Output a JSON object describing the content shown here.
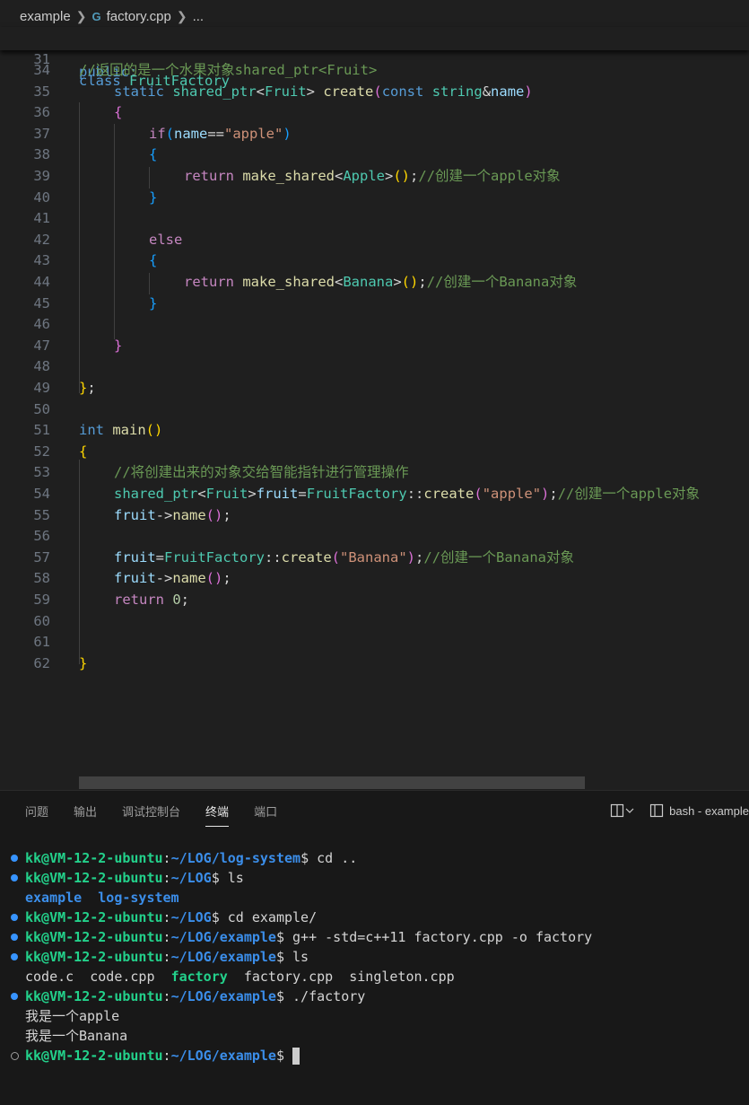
{
  "breadcrumb": {
    "folder": "example",
    "cpp_icon": "C++ file icon",
    "file": "factory.cpp",
    "more": "..."
  },
  "sticky": {
    "line_number": "31",
    "keyword": "class",
    "name": "FruitFactory",
    "partial": "public:"
  },
  "editor": {
    "lines": [
      {
        "n": "34",
        "ind": 0,
        "t": [
          [
            "cm",
            "//返回的是一个水果对象shared_ptr<Fruit>"
          ]
        ]
      },
      {
        "n": "35",
        "ind": 1,
        "t": [
          [
            "kw",
            "static "
          ],
          [
            "ty",
            "shared_ptr"
          ],
          [
            "pl",
            "<"
          ],
          [
            "ty",
            "Fruit"
          ],
          [
            "pl",
            "> "
          ],
          [
            "fn",
            "create"
          ],
          [
            "b2",
            "("
          ],
          [
            "kw",
            "const "
          ],
          [
            "ty",
            "string"
          ],
          [
            "pl",
            "&"
          ],
          [
            "vr",
            "name"
          ],
          [
            "b2",
            ")"
          ]
        ]
      },
      {
        "n": "36",
        "ind": 1,
        "t": [
          [
            "b2",
            "{"
          ]
        ]
      },
      {
        "n": "37",
        "ind": 2,
        "t": [
          [
            "ctl",
            "if"
          ],
          [
            "b3",
            "("
          ],
          [
            "vr",
            "name"
          ],
          [
            "pl",
            "=="
          ],
          [
            "st",
            "\"apple\""
          ],
          [
            "b3",
            ")"
          ]
        ]
      },
      {
        "n": "38",
        "ind": 2,
        "t": [
          [
            "b3",
            "{"
          ]
        ]
      },
      {
        "n": "39",
        "ind": 3,
        "t": [
          [
            "ctl",
            "return "
          ],
          [
            "fn",
            "make_shared"
          ],
          [
            "pl",
            "<"
          ],
          [
            "ty",
            "Apple"
          ],
          [
            "pl",
            ">"
          ],
          [
            "b1",
            "()"
          ],
          [
            "pl",
            ";"
          ],
          [
            "cm",
            "//创建一个apple对象"
          ]
        ]
      },
      {
        "n": "40",
        "ind": 2,
        "t": [
          [
            "b3",
            "}"
          ]
        ]
      },
      {
        "n": "41",
        "ind": 0,
        "t": []
      },
      {
        "n": "42",
        "ind": 2,
        "t": [
          [
            "ctl",
            "else"
          ]
        ]
      },
      {
        "n": "43",
        "ind": 2,
        "t": [
          [
            "b3",
            "{"
          ]
        ]
      },
      {
        "n": "44",
        "ind": 3,
        "t": [
          [
            "ctl",
            "return "
          ],
          [
            "fn",
            "make_shared"
          ],
          [
            "pl",
            "<"
          ],
          [
            "ty",
            "Banana"
          ],
          [
            "pl",
            ">"
          ],
          [
            "b1",
            "()"
          ],
          [
            "pl",
            ";"
          ],
          [
            "cm",
            "//创建一个Banana对象"
          ]
        ]
      },
      {
        "n": "45",
        "ind": 2,
        "t": [
          [
            "b3",
            "}"
          ]
        ]
      },
      {
        "n": "46",
        "ind": 0,
        "t": []
      },
      {
        "n": "47",
        "ind": 1,
        "t": [
          [
            "b2",
            "}"
          ]
        ]
      },
      {
        "n": "48",
        "ind": 0,
        "t": []
      },
      {
        "n": "49",
        "ind": 0,
        "t": [
          [
            "b1",
            "}"
          ],
          [
            "pl",
            ";"
          ]
        ]
      },
      {
        "n": "50",
        "ind": 0,
        "t": []
      },
      {
        "n": "51",
        "ind": 0,
        "t": [
          [
            "kw",
            "int "
          ],
          [
            "fn",
            "main"
          ],
          [
            "b1",
            "()"
          ]
        ]
      },
      {
        "n": "52",
        "ind": 0,
        "t": [
          [
            "b1",
            "{"
          ]
        ]
      },
      {
        "n": "53",
        "ind": 1,
        "t": [
          [
            "cm",
            "//将创建出来的对象交给智能指针进行管理操作"
          ]
        ]
      },
      {
        "n": "54",
        "ind": 1,
        "t": [
          [
            "ty",
            "shared_ptr"
          ],
          [
            "pl",
            "<"
          ],
          [
            "ty",
            "Fruit"
          ],
          [
            "pl",
            ">"
          ],
          [
            "vr",
            "fruit"
          ],
          [
            "pl",
            "="
          ],
          [
            "ty",
            "FruitFactory"
          ],
          [
            "pl",
            "::"
          ],
          [
            "fn",
            "create"
          ],
          [
            "b2",
            "("
          ],
          [
            "st",
            "\"apple\""
          ],
          [
            "b2",
            ")"
          ],
          [
            "pl",
            ";"
          ],
          [
            "cm",
            "//创建一个apple对象"
          ]
        ]
      },
      {
        "n": "55",
        "ind": 1,
        "t": [
          [
            "vr",
            "fruit"
          ],
          [
            "pl",
            "->"
          ],
          [
            "fn",
            "name"
          ],
          [
            "b2",
            "()"
          ],
          [
            "pl",
            ";"
          ]
        ]
      },
      {
        "n": "56",
        "ind": 0,
        "t": []
      },
      {
        "n": "57",
        "ind": 1,
        "t": [
          [
            "vr",
            "fruit"
          ],
          [
            "pl",
            "="
          ],
          [
            "ty",
            "FruitFactory"
          ],
          [
            "pl",
            "::"
          ],
          [
            "fn",
            "create"
          ],
          [
            "b2",
            "("
          ],
          [
            "st",
            "\"Banana\""
          ],
          [
            "b2",
            ")"
          ],
          [
            "pl",
            ";"
          ],
          [
            "cm",
            "//创建一个Banana对象"
          ]
        ]
      },
      {
        "n": "58",
        "ind": 1,
        "t": [
          [
            "vr",
            "fruit"
          ],
          [
            "pl",
            "->"
          ],
          [
            "fn",
            "name"
          ],
          [
            "b2",
            "()"
          ],
          [
            "pl",
            ";"
          ]
        ]
      },
      {
        "n": "59",
        "ind": 1,
        "t": [
          [
            "ctl",
            "return "
          ],
          [
            "nm",
            "0"
          ],
          [
            "pl",
            ";"
          ]
        ]
      },
      {
        "n": "60",
        "ind": 0,
        "t": []
      },
      {
        "n": "61",
        "ind": 0,
        "t": []
      },
      {
        "n": "62",
        "ind": 0,
        "t": [
          [
            "b1",
            "}"
          ]
        ]
      }
    ]
  },
  "panel": {
    "tabs": [
      "问题",
      "输出",
      "调试控制台",
      "终端",
      "端口"
    ],
    "active_tab": "终端",
    "split_icon": "split-terminal-icon",
    "terminal_name": "bash - example"
  },
  "terminal": {
    "lines": [
      {
        "dot": "filled",
        "t": [
          [
            "u",
            "kk@VM-12-2-ubuntu"
          ],
          [
            "pl",
            ":"
          ],
          [
            "p",
            "~/LOG/log-system"
          ],
          [
            "pl",
            "$ cd .."
          ]
        ]
      },
      {
        "dot": "filled",
        "t": [
          [
            "u",
            "kk@VM-12-2-ubuntu"
          ],
          [
            "pl",
            ":"
          ],
          [
            "p",
            "~/LOG"
          ],
          [
            "pl",
            "$ ls"
          ]
        ]
      },
      {
        "dot": "none",
        "t": [
          [
            "dirb",
            "example"
          ],
          [
            "pl",
            "  "
          ],
          [
            "dirb",
            "log-system"
          ]
        ]
      },
      {
        "dot": "filled",
        "t": [
          [
            "u",
            "kk@VM-12-2-ubuntu"
          ],
          [
            "pl",
            ":"
          ],
          [
            "p",
            "~/LOG"
          ],
          [
            "pl",
            "$ cd example/"
          ]
        ]
      },
      {
        "dot": "filled",
        "t": [
          [
            "u",
            "kk@VM-12-2-ubuntu"
          ],
          [
            "pl",
            ":"
          ],
          [
            "p",
            "~/LOG/example"
          ],
          [
            "pl",
            "$ g++ -std=c++11 factory.cpp -o factory"
          ]
        ]
      },
      {
        "dot": "filled",
        "t": [
          [
            "u",
            "kk@VM-12-2-ubuntu"
          ],
          [
            "pl",
            ":"
          ],
          [
            "p",
            "~/LOG/example"
          ],
          [
            "pl",
            "$ ls"
          ]
        ]
      },
      {
        "dot": "none",
        "t": [
          [
            "pl",
            "code.c  code.cpp  "
          ],
          [
            "exe",
            "factory"
          ],
          [
            "pl",
            "  factory.cpp  singleton.cpp"
          ]
        ]
      },
      {
        "dot": "filled",
        "t": [
          [
            "u",
            "kk@VM-12-2-ubuntu"
          ],
          [
            "pl",
            ":"
          ],
          [
            "p",
            "~/LOG/example"
          ],
          [
            "pl",
            "$ ./factory"
          ]
        ]
      },
      {
        "dot": "none",
        "t": [
          [
            "pl",
            "我是一个apple"
          ]
        ]
      },
      {
        "dot": "none",
        "t": [
          [
            "pl",
            "我是一个Banana"
          ]
        ]
      },
      {
        "dot": "hollow",
        "t": [
          [
            "u",
            "kk@VM-12-2-ubuntu"
          ],
          [
            "pl",
            ":"
          ],
          [
            "p",
            "~/LOG/example"
          ],
          [
            "pl",
            "$ "
          ]
        ],
        "cursor": true
      }
    ]
  }
}
